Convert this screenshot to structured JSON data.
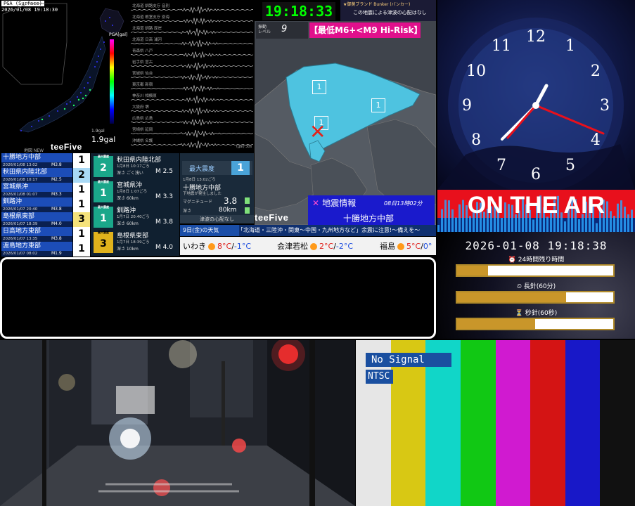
{
  "pga": {
    "header": "PGA (Surface)",
    "time": "2026/01/08 19:18:30",
    "unit_label": "PGA[gal]",
    "gal_value": "1.9gal",
    "gal_label": "1.9gal",
    "new_label": "地図 NEW"
  },
  "brand": {
    "teefive": "teeFive"
  },
  "waveform": {
    "stations": [
      "北海道 釧路支庁 音別",
      "北海道 根室支庁 別海",
      "北海道 釧路 厚岸",
      "北海道 日高 浦河",
      "青森県 八戸",
      "岩手県 宮古",
      "宮城県 仙台",
      "東京都 新宿",
      "神奈川 相模原",
      "大阪府 堺",
      "広島県 広島",
      "宮崎県 延岡",
      "沖縄県 名護"
    ],
    "footer": "(gal) 30s"
  },
  "clock_digital": "19:18:33",
  "bunker": {
    "line1": "★御莫ブランド Bunker (バンカー)",
    "line2": "この地震による津波の心配はなし"
  },
  "level": {
    "label1": "振動",
    "label2": "レベル",
    "value": "9"
  },
  "risk_label": "【最低M6+<M9 Hi-Risk】",
  "map_intensities": [
    "1",
    "1",
    "1"
  ],
  "eew": {
    "title": "地震情報",
    "date": "08日13時02分",
    "region": "十勝地方中部"
  },
  "recent": [
    {
      "name": "十勝地方中部",
      "time": "2026/01/08 13:02",
      "mag": "M3.8",
      "int": "1",
      "color": "#ffffff"
    },
    {
      "name": "秋田県内陸北部",
      "time": "2026/01/08 10:17",
      "mag": "M2.5",
      "int": "2",
      "color": "#a9d9f5"
    },
    {
      "name": "宮城県沖",
      "time": "2026/01/08 01:07",
      "mag": "M3.3",
      "int": "1",
      "color": "#ffffff"
    },
    {
      "name": "釧路沖",
      "time": "2026/01/07 20:40",
      "mag": "M3.8",
      "int": "1",
      "color": "#ffffff"
    },
    {
      "name": "島根県東部",
      "time": "2026/01/07 18:39",
      "mag": "M4.0",
      "int": "3",
      "color": "#f5e27a"
    },
    {
      "name": "日高地方東部",
      "time": "2026/01/07 13:35",
      "mag": "M3.8",
      "int": "1",
      "color": "#ffffff"
    },
    {
      "name": "渡島地方東部",
      "time": "2026/01/07 08:02",
      "mag": "M1.9",
      "int": "1",
      "color": "#ffffff"
    }
  ],
  "detail": [
    {
      "box_label": "最大震度",
      "int": "2",
      "name": "秋田県内陸北部",
      "time": "1月8日 10:17ごろ",
      "depth": "深さ ごく浅い",
      "mag": "M 2.5"
    },
    {
      "box_label": "最大震度",
      "int": "1",
      "name": "宮城県沖",
      "time": "1月8日 1:07ごろ",
      "depth": "深さ 60km",
      "mag": "M 3.3"
    },
    {
      "box_label": "最大震度",
      "int": "1",
      "name": "釧路沖",
      "time": "1月7日 20:40ごろ",
      "depth": "深さ 60km",
      "mag": "M 3.8"
    },
    {
      "box_label": "最大震度",
      "int": "3",
      "name": "島根県東部",
      "time": "1月7日 18:39ごろ",
      "depth": "深さ 10km",
      "mag": "M 4.0"
    }
  ],
  "maxint": {
    "label": "最大震度",
    "value": "1",
    "time": "1月8日 13:02ごろ",
    "region": "十勝地方中部",
    "note": "下地震が発生しました",
    "mag_label": "マグニチュード",
    "mag_value": "3.8",
    "depth_label": "深さ",
    "depth_value": "80km",
    "tsunami": "津波の心配なし"
  },
  "ticker": {
    "day": "9日(金)の天気",
    "message": "「北海道・三陸沖・関東〜中国・九州地方など」余震に注意!〜備えを〜"
  },
  "weather": [
    {
      "city": "いわき",
      "hi": "8°C",
      "lo": "-1°C"
    },
    {
      "city": "会津若松",
      "hi": "2°C",
      "lo": "-2°C"
    },
    {
      "city": "福島",
      "hi": "5°C",
      "lo": "0°"
    }
  ],
  "clock_numbers": [
    "12",
    "1",
    "2",
    "3",
    "4",
    "5",
    "6",
    "7",
    "8",
    "9",
    "10",
    "11"
  ],
  "onair": "ON THE AIR",
  "datetime": "2026-01-08 19:18:38",
  "progress": [
    {
      "label": "⏰ 24時間残り時間",
      "fraction": 0.2
    },
    {
      "label": "⏲ 長針(60分)",
      "fraction": 0.7
    },
    {
      "label": "⏳ 秒針(60秒)",
      "fraction": 0.5
    }
  ],
  "colorbars": {
    "no_signal": "No Signal",
    "ntsc": "NTSC",
    "colors": [
      "#e6e6e6",
      "#d8c814",
      "#11d6c8",
      "#11c814",
      "#d01ad0",
      "#d41414",
      "#1818c8",
      "#111111"
    ]
  }
}
